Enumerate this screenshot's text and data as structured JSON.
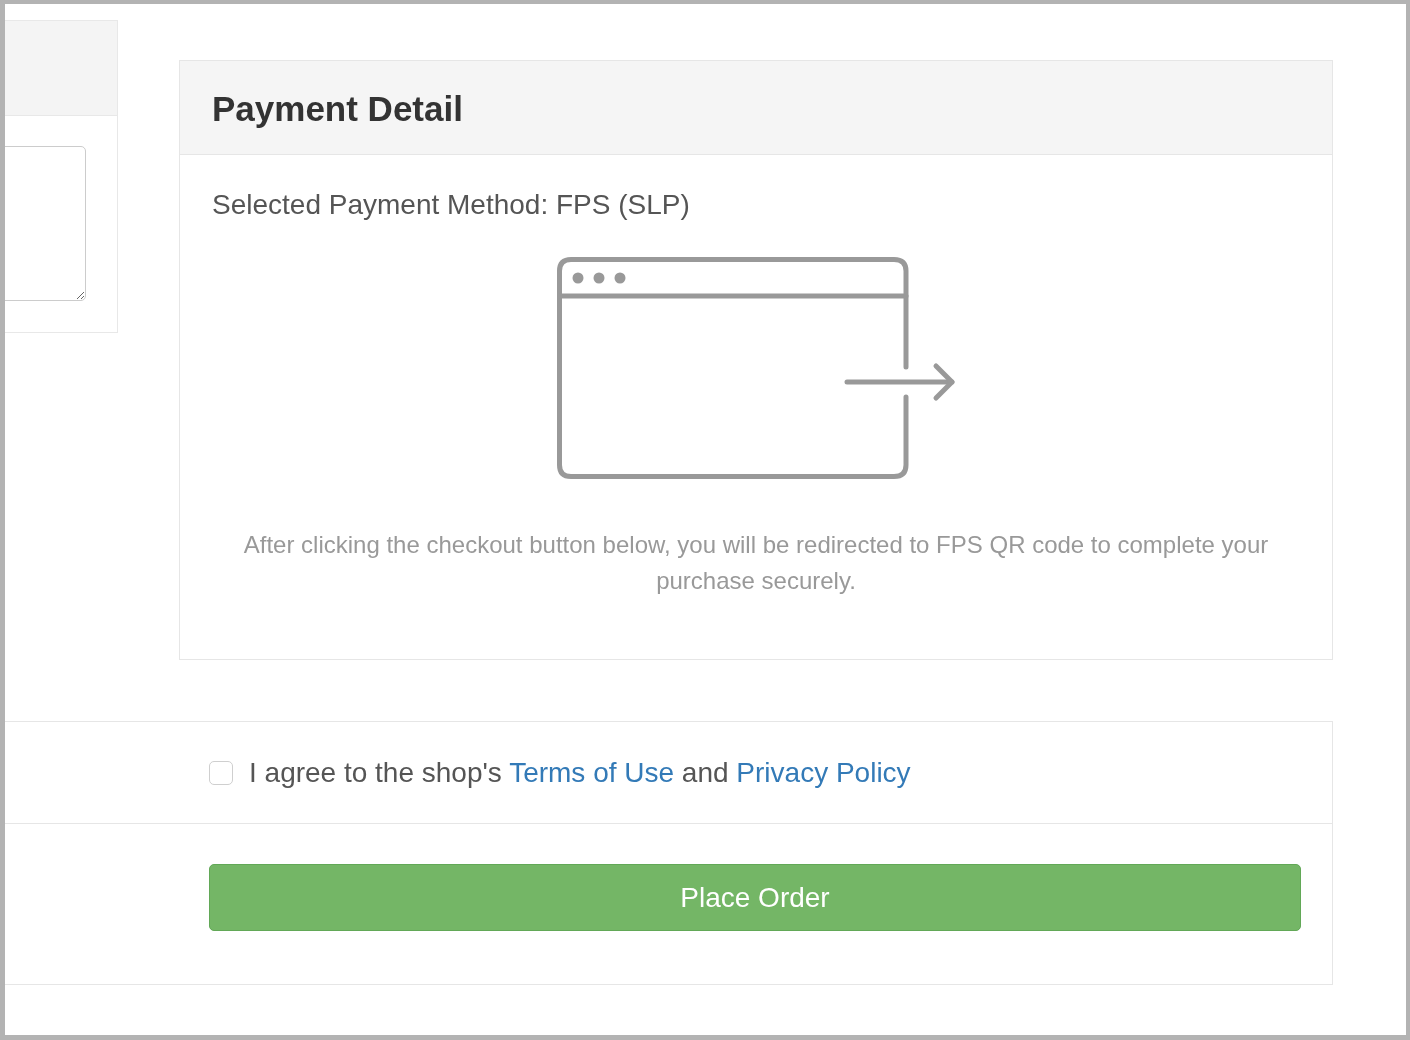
{
  "payment_detail": {
    "title": "Payment Detail",
    "selected_method": "Selected Payment Method: FPS (SLP)",
    "description": "After clicking the checkout button below, you will be redirected to FPS QR code to complete your purchase securely."
  },
  "agreement": {
    "checked": false,
    "segments": [
      {
        "kind": "text",
        "text": "I agree to the shop's "
      },
      {
        "kind": "link",
        "text": "Terms of Use"
      },
      {
        "kind": "text",
        "text": " and "
      },
      {
        "kind": "link",
        "text": "Privacy Policy"
      }
    ]
  },
  "place_order_button": {
    "label": "Place Order"
  }
}
